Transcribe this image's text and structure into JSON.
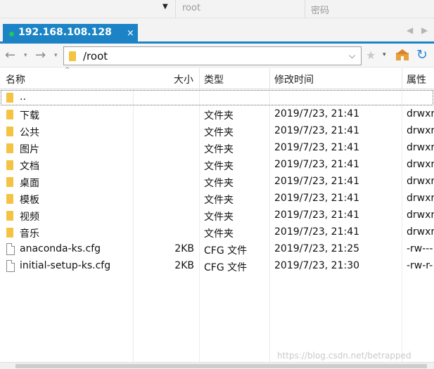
{
  "connection": {
    "user_placeholder": "root",
    "password_placeholder": "密码"
  },
  "tab": {
    "title": "192.168.108.128",
    "close_glyph": "×"
  },
  "tab_nav": {
    "prev_glyph": "◀",
    "next_glyph": "▶"
  },
  "toolbar": {
    "back_glyph": "←",
    "forward_glyph": "→",
    "path": "/root",
    "dropdown_glyph": "⌵",
    "star_glyph": "★",
    "caret_glyph": "▾",
    "refresh_glyph": "↻"
  },
  "columns": {
    "name": "名称",
    "size": "大小",
    "type": "类型",
    "modified": "修改时间",
    "attrs": "属性"
  },
  "rows": [
    {
      "name": "..",
      "size": "",
      "type": "",
      "modified": "",
      "attrs": "",
      "kind": "folder"
    },
    {
      "name": "下载",
      "size": "",
      "type": "文件夹",
      "modified": "2019/7/23, 21:41",
      "attrs": "drwxr",
      "kind": "folder"
    },
    {
      "name": "公共",
      "size": "",
      "type": "文件夹",
      "modified": "2019/7/23, 21:41",
      "attrs": "drwxr",
      "kind": "folder"
    },
    {
      "name": "图片",
      "size": "",
      "type": "文件夹",
      "modified": "2019/7/23, 21:41",
      "attrs": "drwxr",
      "kind": "folder"
    },
    {
      "name": "文档",
      "size": "",
      "type": "文件夹",
      "modified": "2019/7/23, 21:41",
      "attrs": "drwxr",
      "kind": "folder"
    },
    {
      "name": "桌面",
      "size": "",
      "type": "文件夹",
      "modified": "2019/7/23, 21:41",
      "attrs": "drwxr",
      "kind": "folder"
    },
    {
      "name": "模板",
      "size": "",
      "type": "文件夹",
      "modified": "2019/7/23, 21:41",
      "attrs": "drwxr",
      "kind": "folder"
    },
    {
      "name": "视频",
      "size": "",
      "type": "文件夹",
      "modified": "2019/7/23, 21:41",
      "attrs": "drwxr",
      "kind": "folder"
    },
    {
      "name": "音乐",
      "size": "",
      "type": "文件夹",
      "modified": "2019/7/23, 21:41",
      "attrs": "drwxr",
      "kind": "folder"
    },
    {
      "name": "anaconda-ks.cfg",
      "size": "2KB",
      "type": "CFG 文件",
      "modified": "2019/7/23, 21:25",
      "attrs": "-rw---",
      "kind": "file"
    },
    {
      "name": "initial-setup-ks.cfg",
      "size": "2KB",
      "type": "CFG 文件",
      "modified": "2019/7/23, 21:30",
      "attrs": "-rw-r-",
      "kind": "file"
    }
  ],
  "watermark": "https://blog.csdn.net/betrapped",
  "colors": {
    "accent": "#1c84c6",
    "folder": "#f5c342",
    "online_dot": "#22c55e"
  }
}
